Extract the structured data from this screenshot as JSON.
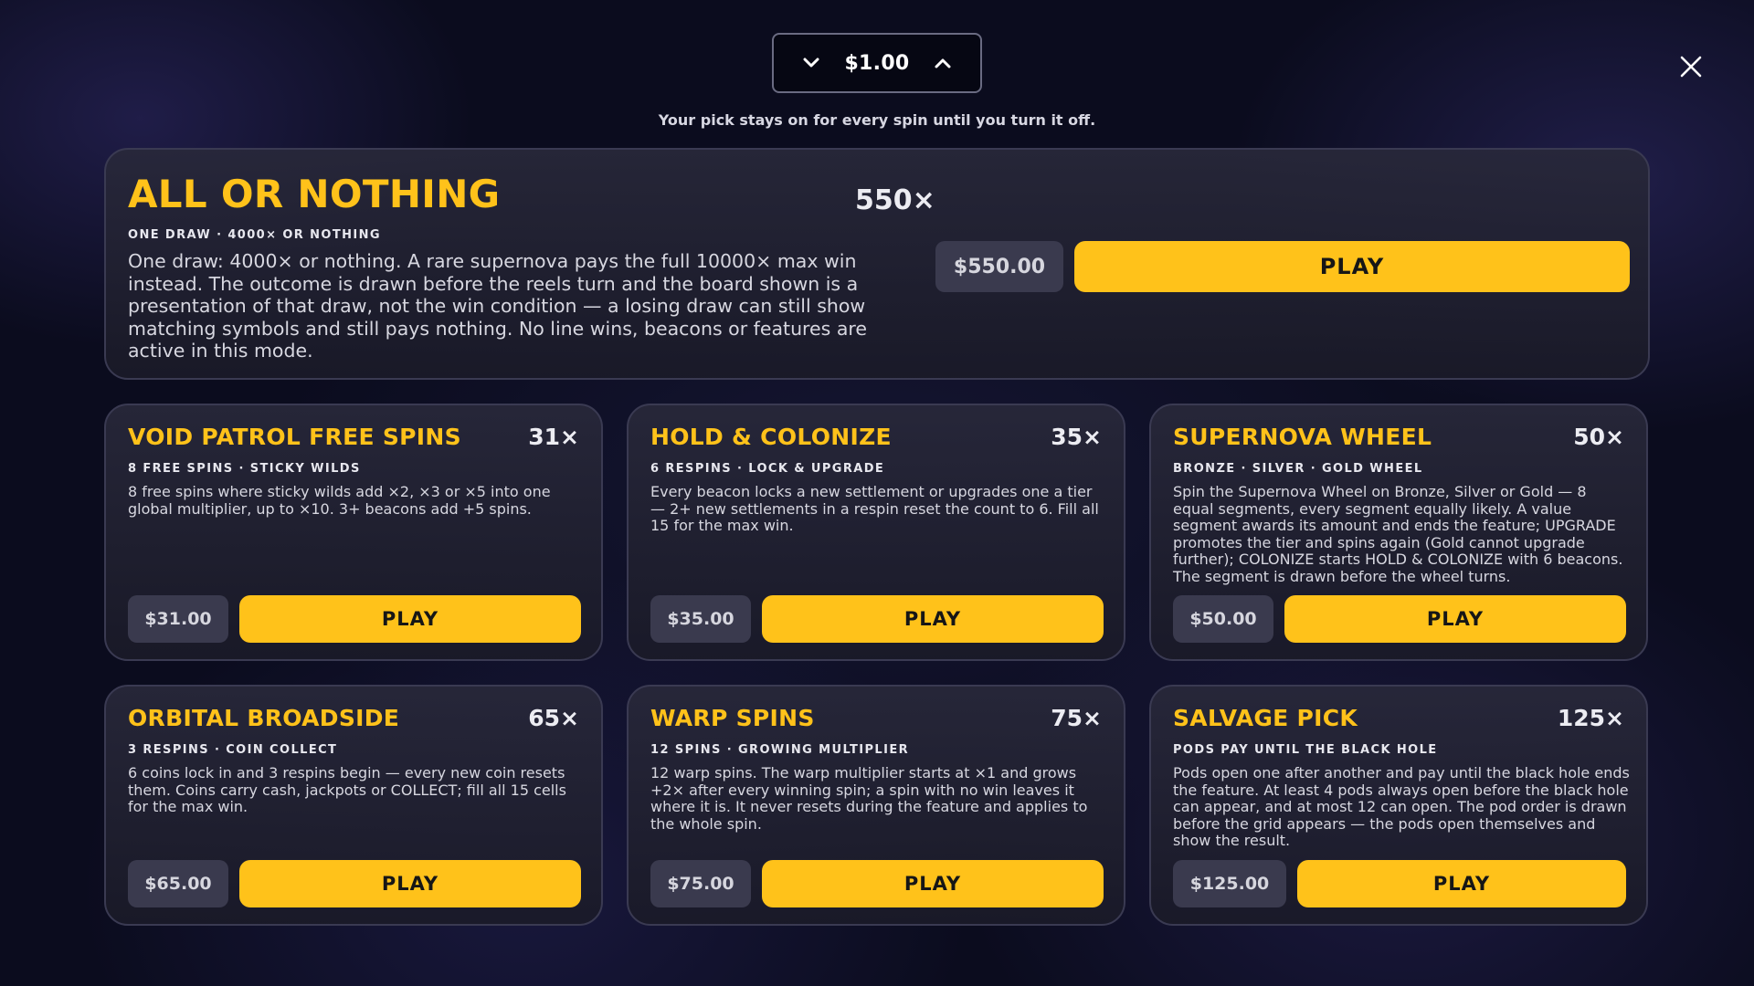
{
  "bet": {
    "value": "$1.00"
  },
  "hint": "Your pick stays on for every spin until you turn it off.",
  "hero": {
    "title": "ALL OR NOTHING",
    "multiplier": "550×",
    "subtitle": "ONE DRAW · 4000× OR NOTHING",
    "description": "One draw: 4000× or nothing. A rare supernova pays the full 10000× max win instead. The outcome is drawn before the reels turn and the board shown is a presentation of that draw, not the win condition — a losing draw can still show matching symbols and still pays nothing. No line wins, beacons or features are active in this mode.",
    "cost": "$550.00",
    "play": "PLAY"
  },
  "cards": [
    {
      "title": "VOID PATROL FREE SPINS",
      "multiplier": "31×",
      "subtitle": "8 FREE SPINS · STICKY WILDS",
      "description": "8 free spins where sticky wilds add ×2, ×3 or ×5 into one global multiplier, up to ×10. 3+ beacons add +5 spins.",
      "cost": "$31.00",
      "play": "PLAY"
    },
    {
      "title": "HOLD & COLONIZE",
      "multiplier": "35×",
      "subtitle": "6 RESPINS · LOCK & UPGRADE",
      "description": "Every beacon locks a new settlement or upgrades one a tier — 2+ new settlements in a respin reset the count to 6. Fill all 15 for the max win.",
      "cost": "$35.00",
      "play": "PLAY"
    },
    {
      "title": "SUPERNOVA WHEEL",
      "multiplier": "50×",
      "subtitle": "BRONZE · SILVER · GOLD WHEEL",
      "description": "Spin the Supernova Wheel on Bronze, Silver or Gold — 8 equal segments, every segment equally likely. A value segment awards its amount and ends the feature; UPGRADE promotes the tier and spins again (Gold cannot upgrade further); COLONIZE starts HOLD & COLONIZE with 6 beacons. The segment is drawn before the wheel turns.",
      "cost": "$50.00",
      "play": "PLAY"
    },
    {
      "title": "ORBITAL BROADSIDE",
      "multiplier": "65×",
      "subtitle": "3 RESPINS · COIN COLLECT",
      "description": "6 coins lock in and 3 respins begin — every new coin resets them. Coins carry cash, jackpots or COLLECT; fill all 15 cells for the max win.",
      "cost": "$65.00",
      "play": "PLAY"
    },
    {
      "title": "WARP SPINS",
      "multiplier": "75×",
      "subtitle": "12 SPINS · GROWING MULTIPLIER",
      "description": "12 warp spins. The warp multiplier starts at ×1 and grows +2× after every winning spin; a spin with no win leaves it where it is. It never resets during the feature and applies to the whole spin.",
      "cost": "$75.00",
      "play": "PLAY"
    },
    {
      "title": "SALVAGE PICK",
      "multiplier": "125×",
      "subtitle": "PODS PAY UNTIL THE BLACK HOLE",
      "description": "Pods open one after another and pay until the black hole ends the feature. At least 4 pods always open before the black hole can appear, and at most 12 can open. The pod order is drawn before the grid appears — the pods open themselves and show the result.",
      "cost": "$125.00",
      "play": "PLAY"
    }
  ]
}
